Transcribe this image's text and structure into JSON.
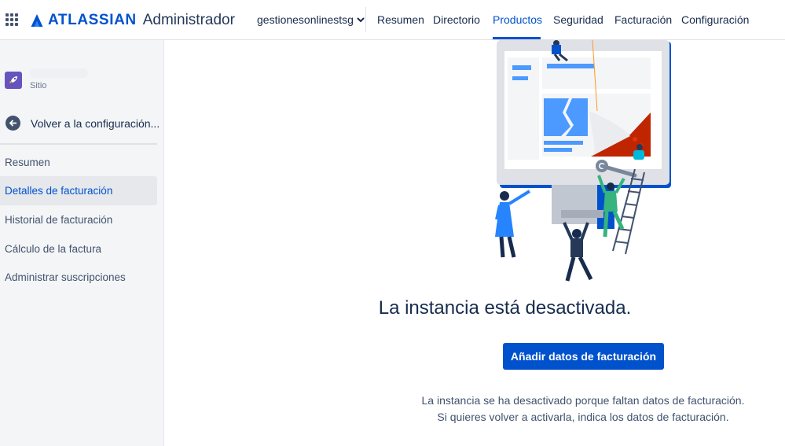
{
  "topbar": {
    "brand": "ATLASSIAN",
    "product": "Administrador",
    "org": "gestionesonlinestsg",
    "tabs": [
      "Resumen",
      "Directorio",
      "Productos",
      "Seguridad",
      "Facturación",
      "Configuración"
    ],
    "active_tab": "Productos"
  },
  "sidebar": {
    "site_label": "Sitio",
    "back_label": "Volver a la configuración...",
    "items": [
      {
        "label": "Resumen"
      },
      {
        "label": "Detalles de facturación",
        "active": true
      },
      {
        "label": "Historial de facturación"
      },
      {
        "label": "Cálculo de la factura"
      },
      {
        "label": "Administrar suscripciones"
      }
    ]
  },
  "main": {
    "title": "La instancia está desactivada.",
    "button_label": "Añadir datos de facturación",
    "desc_line1": "La instancia se ha desactivado porque faltan datos de facturación.",
    "desc_line2": "Si quieres volver a activarla, indica los datos de facturación."
  },
  "colors": {
    "brand_blue": "#0052cc",
    "active_bg": "#e6e8ec",
    "sidebar_bg": "#f4f5f7"
  },
  "icons": [
    "app-switcher-icon",
    "atlassian-logo-icon",
    "chevron-down-icon",
    "rocket-icon",
    "arrow-left-icon"
  ]
}
